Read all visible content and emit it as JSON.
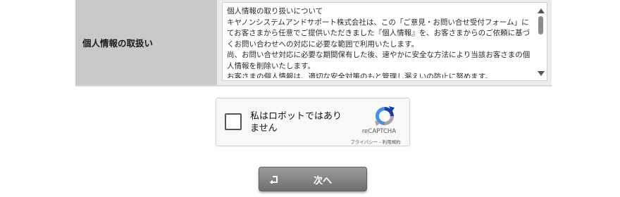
{
  "privacy_row": {
    "label": "個人情報の取扱い",
    "paragraphs": [
      "個人情報の取り扱いについて",
      "キヤノンシステムアンドサポート株式会社は、この「ご意見・お問い合せ受付フォーム」にてお客さまから任意でご提供いただきました『個人情報』を、お客さまからのご依頼に基づくお問い合わせへの対応に必要な範囲で利用いたします。",
      "尚、お問い合せ対応に必要な期間保有した後、速やかに安全な方法により当該お客さまの個人情報を削除いたします。",
      "お客さまの個人情報は、適切な安全対策のもと管理し漏えいの防止に努めます。"
    ]
  },
  "recaptcha": {
    "label": "私はロボットではありません",
    "brand": "reCAPTCHA",
    "privacy_link": "プライバシー",
    "separator": " - ",
    "terms_link": "利用規約"
  },
  "next_button": {
    "label": "次へ",
    "icon": "return-arrow-icon"
  },
  "colors": {
    "label_bg": "#c9c9c9",
    "row_bg": "#ebebeb",
    "button_bg": "#7f7f7f",
    "recaptcha_blue": "#4a90e2",
    "recaptcha_grey": "#a6a6a6"
  }
}
